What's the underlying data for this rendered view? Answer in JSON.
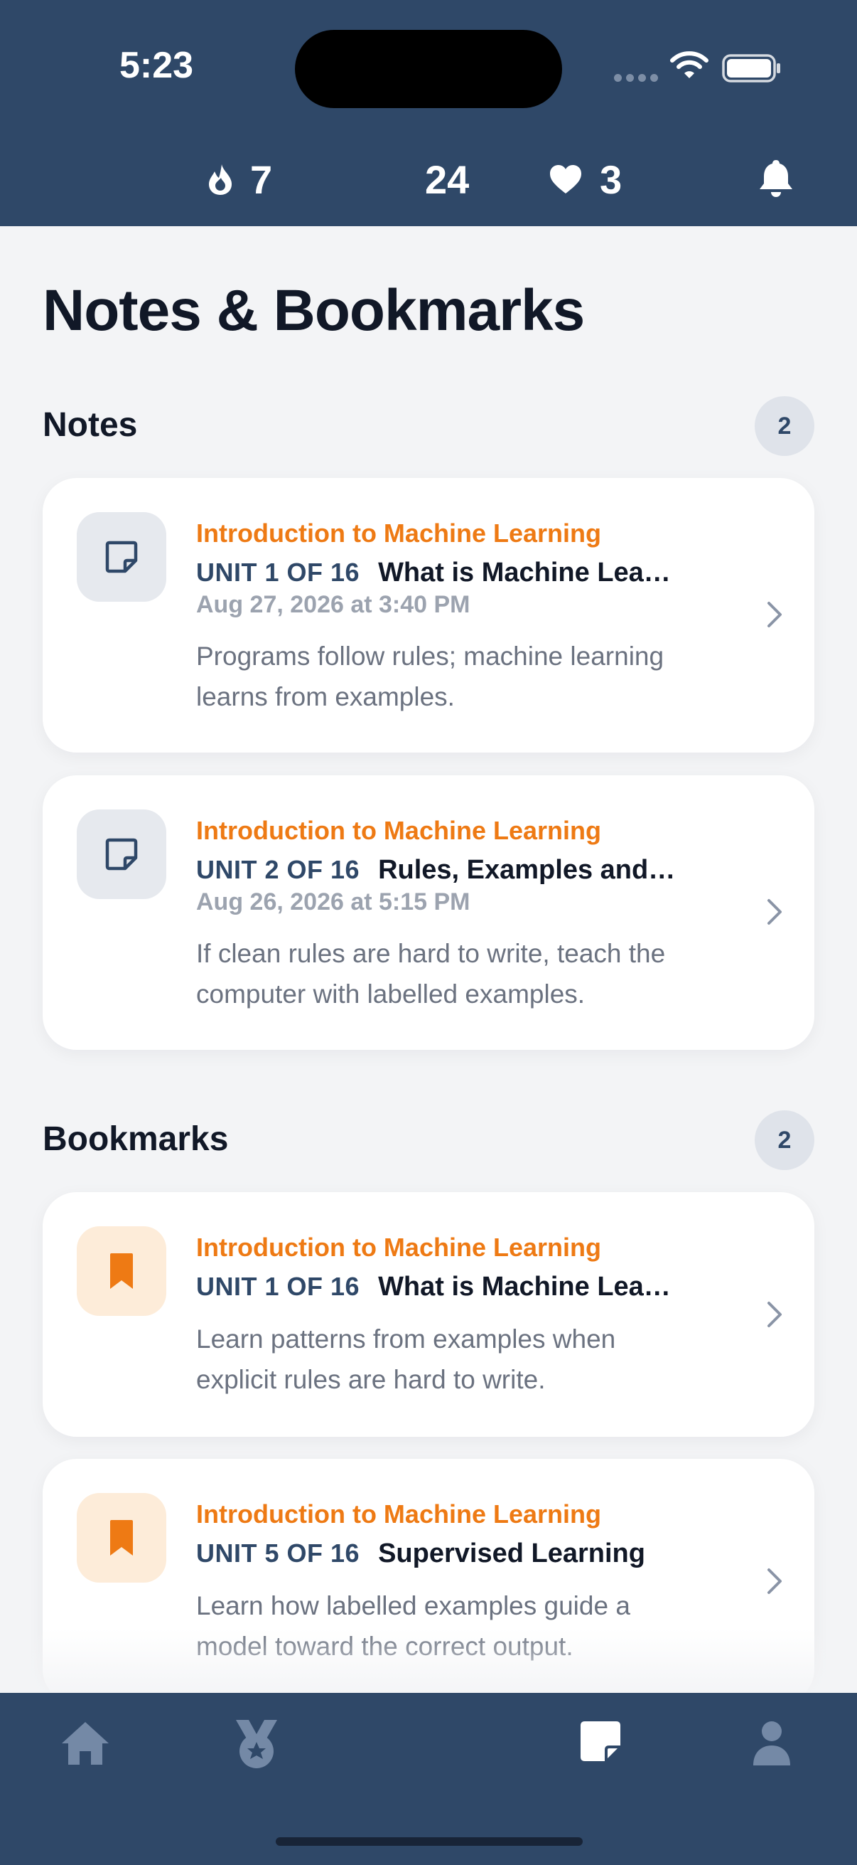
{
  "status_bar": {
    "time": "5:23"
  },
  "stats": {
    "streak": "7",
    "xp": "24",
    "hearts": "3"
  },
  "page_title": "Notes & Bookmarks",
  "notes": {
    "title": "Notes",
    "count": "2",
    "items": [
      {
        "course": "Introduction to Machine Learning",
        "unit": "UNIT 1 OF 16",
        "lesson": "What is Machine Lea…",
        "date": "Aug 27, 2026 at 3:40 PM",
        "text": "Programs follow rules; machine learning learns from examples."
      },
      {
        "course": "Introduction to Machine Learning",
        "unit": "UNIT 2 OF 16",
        "lesson": "Rules, Examples and…",
        "date": "Aug 26, 2026 at 5:15 PM",
        "text": "If clean rules are hard to write, teach the computer with labelled examples."
      }
    ]
  },
  "bookmarks": {
    "title": "Bookmarks",
    "count": "2",
    "items": [
      {
        "course": "Introduction to Machine Learning",
        "unit": "UNIT 1 OF 16",
        "lesson": "What is Machine Lea…",
        "text": "Learn patterns from examples when explicit rules are hard to write."
      },
      {
        "course": "Introduction to Machine Learning",
        "unit": "UNIT 5 OF 16",
        "lesson": "Supervised Learning",
        "text": "Learn how labelled examples guide a model toward the correct output."
      }
    ]
  },
  "tabs": [
    {
      "icon": "home-icon"
    },
    {
      "icon": "medal-icon"
    },
    {
      "icon": "notes-icon",
      "active": true
    },
    {
      "icon": "profile-icon"
    }
  ],
  "colors": {
    "header_bg": "#2f4868",
    "accent_orange": "#ee7a14",
    "unit_blue": "#2f4868",
    "page_bg": "#f3f4f6"
  }
}
